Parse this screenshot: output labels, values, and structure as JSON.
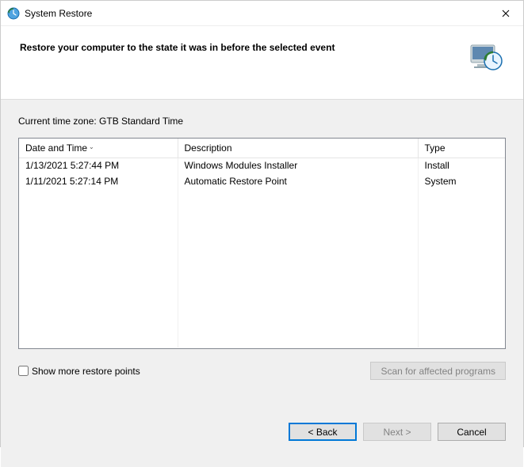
{
  "window": {
    "title": "System Restore"
  },
  "header": {
    "heading": "Restore your computer to the state it was in before the selected event"
  },
  "content": {
    "timezoneLabel": "Current time zone: GTB Standard Time",
    "columns": {
      "datetime": "Date and Time",
      "description": "Description",
      "type": "Type"
    },
    "rows": [
      {
        "datetime": "1/13/2021 5:27:44 PM",
        "description": "Windows Modules Installer",
        "type": "Install"
      },
      {
        "datetime": "1/11/2021 5:27:14 PM",
        "description": "Automatic Restore Point",
        "type": "System"
      }
    ],
    "showMoreLabel": "Show more restore points",
    "scanLabel": "Scan for affected programs"
  },
  "footer": {
    "back": "< Back",
    "next": "Next >",
    "cancel": "Cancel"
  }
}
